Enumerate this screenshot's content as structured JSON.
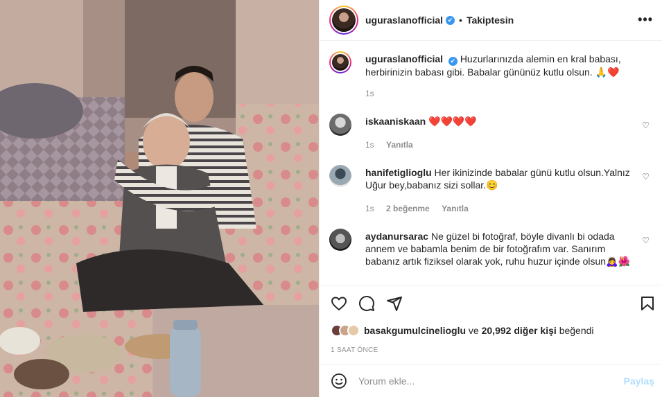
{
  "post": {
    "username": "uguraslanofficial",
    "verified_icon": "✔",
    "follow_status": "Takiptesin",
    "more_icon": "•••"
  },
  "caption": {
    "username": "uguraslanofficial",
    "text": "Huzurlarınızda alemin en kral babası, herbirinizin babası gibi. Babalar gününüz kutlu olsun. 🙏❤️",
    "time": "1s"
  },
  "comments": [
    {
      "username": "iskaaniskaan",
      "text": "❤️❤️❤️❤️",
      "time": "1s",
      "likes": "",
      "reply": "Yanıtla"
    },
    {
      "username": "hanifetiglioglu",
      "text": "Her ikinizinde babalar günü kutlu olsun.Yalnız Uğur bey,babanız sizi sollar.😊",
      "time": "1s",
      "likes": "2 beğenme",
      "reply": "Yanıtla"
    },
    {
      "username": "aydanursarac",
      "text": "Ne güzel bi fotoğraf, böyle divanlı bi odada annem ve babamla benim de bir fotoğrafım var. Sanırım babanız artık fiziksel olarak yok, ruhu huzur içinde olsun🙇‍♀️🌺",
      "time": "",
      "likes": "",
      "reply": ""
    }
  ],
  "likes": {
    "user": "basakgumulcinelioglu",
    "connector": "ve",
    "others": "20,992 diğer kişi",
    "suffix": "beğendi"
  },
  "timestamp": "1 SAAT ÖNCE",
  "add_comment": {
    "placeholder": "Yorum ekle...",
    "post_label": "Paylaş"
  },
  "colors": {
    "accent": "#3897f0",
    "post_disabled": "#b2dffc",
    "muted": "#8e8e8e"
  }
}
